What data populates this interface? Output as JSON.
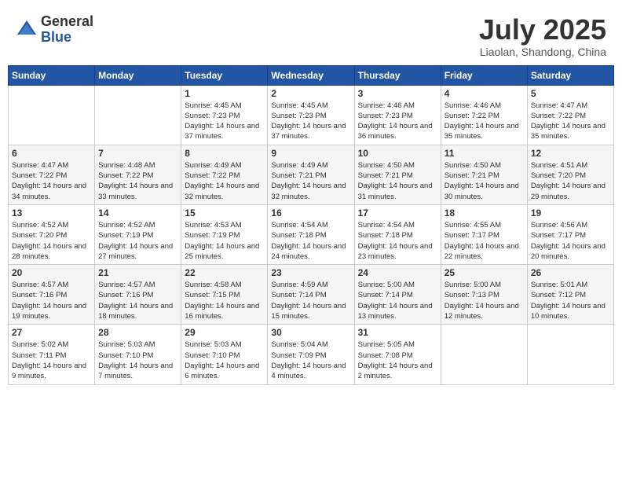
{
  "header": {
    "logo_general": "General",
    "logo_blue": "Blue",
    "month_title": "July 2025",
    "location": "Liaolan, Shandong, China"
  },
  "calendar": {
    "days_of_week": [
      "Sunday",
      "Monday",
      "Tuesday",
      "Wednesday",
      "Thursday",
      "Friday",
      "Saturday"
    ],
    "weeks": [
      [
        {
          "day": "",
          "info": ""
        },
        {
          "day": "",
          "info": ""
        },
        {
          "day": "1",
          "info": "Sunrise: 4:45 AM\nSunset: 7:23 PM\nDaylight: 14 hours and 37 minutes."
        },
        {
          "day": "2",
          "info": "Sunrise: 4:45 AM\nSunset: 7:23 PM\nDaylight: 14 hours and 37 minutes."
        },
        {
          "day": "3",
          "info": "Sunrise: 4:46 AM\nSunset: 7:23 PM\nDaylight: 14 hours and 36 minutes."
        },
        {
          "day": "4",
          "info": "Sunrise: 4:46 AM\nSunset: 7:22 PM\nDaylight: 14 hours and 35 minutes."
        },
        {
          "day": "5",
          "info": "Sunrise: 4:47 AM\nSunset: 7:22 PM\nDaylight: 14 hours and 35 minutes."
        }
      ],
      [
        {
          "day": "6",
          "info": "Sunrise: 4:47 AM\nSunset: 7:22 PM\nDaylight: 14 hours and 34 minutes."
        },
        {
          "day": "7",
          "info": "Sunrise: 4:48 AM\nSunset: 7:22 PM\nDaylight: 14 hours and 33 minutes."
        },
        {
          "day": "8",
          "info": "Sunrise: 4:49 AM\nSunset: 7:22 PM\nDaylight: 14 hours and 32 minutes."
        },
        {
          "day": "9",
          "info": "Sunrise: 4:49 AM\nSunset: 7:21 PM\nDaylight: 14 hours and 32 minutes."
        },
        {
          "day": "10",
          "info": "Sunrise: 4:50 AM\nSunset: 7:21 PM\nDaylight: 14 hours and 31 minutes."
        },
        {
          "day": "11",
          "info": "Sunrise: 4:50 AM\nSunset: 7:21 PM\nDaylight: 14 hours and 30 minutes."
        },
        {
          "day": "12",
          "info": "Sunrise: 4:51 AM\nSunset: 7:20 PM\nDaylight: 14 hours and 29 minutes."
        }
      ],
      [
        {
          "day": "13",
          "info": "Sunrise: 4:52 AM\nSunset: 7:20 PM\nDaylight: 14 hours and 28 minutes."
        },
        {
          "day": "14",
          "info": "Sunrise: 4:52 AM\nSunset: 7:19 PM\nDaylight: 14 hours and 27 minutes."
        },
        {
          "day": "15",
          "info": "Sunrise: 4:53 AM\nSunset: 7:19 PM\nDaylight: 14 hours and 25 minutes."
        },
        {
          "day": "16",
          "info": "Sunrise: 4:54 AM\nSunset: 7:18 PM\nDaylight: 14 hours and 24 minutes."
        },
        {
          "day": "17",
          "info": "Sunrise: 4:54 AM\nSunset: 7:18 PM\nDaylight: 14 hours and 23 minutes."
        },
        {
          "day": "18",
          "info": "Sunrise: 4:55 AM\nSunset: 7:17 PM\nDaylight: 14 hours and 22 minutes."
        },
        {
          "day": "19",
          "info": "Sunrise: 4:56 AM\nSunset: 7:17 PM\nDaylight: 14 hours and 20 minutes."
        }
      ],
      [
        {
          "day": "20",
          "info": "Sunrise: 4:57 AM\nSunset: 7:16 PM\nDaylight: 14 hours and 19 minutes."
        },
        {
          "day": "21",
          "info": "Sunrise: 4:57 AM\nSunset: 7:16 PM\nDaylight: 14 hours and 18 minutes."
        },
        {
          "day": "22",
          "info": "Sunrise: 4:58 AM\nSunset: 7:15 PM\nDaylight: 14 hours and 16 minutes."
        },
        {
          "day": "23",
          "info": "Sunrise: 4:59 AM\nSunset: 7:14 PM\nDaylight: 14 hours and 15 minutes."
        },
        {
          "day": "24",
          "info": "Sunrise: 5:00 AM\nSunset: 7:14 PM\nDaylight: 14 hours and 13 minutes."
        },
        {
          "day": "25",
          "info": "Sunrise: 5:00 AM\nSunset: 7:13 PM\nDaylight: 14 hours and 12 minutes."
        },
        {
          "day": "26",
          "info": "Sunrise: 5:01 AM\nSunset: 7:12 PM\nDaylight: 14 hours and 10 minutes."
        }
      ],
      [
        {
          "day": "27",
          "info": "Sunrise: 5:02 AM\nSunset: 7:11 PM\nDaylight: 14 hours and 9 minutes."
        },
        {
          "day": "28",
          "info": "Sunrise: 5:03 AM\nSunset: 7:10 PM\nDaylight: 14 hours and 7 minutes."
        },
        {
          "day": "29",
          "info": "Sunrise: 5:03 AM\nSunset: 7:10 PM\nDaylight: 14 hours and 6 minutes."
        },
        {
          "day": "30",
          "info": "Sunrise: 5:04 AM\nSunset: 7:09 PM\nDaylight: 14 hours and 4 minutes."
        },
        {
          "day": "31",
          "info": "Sunrise: 5:05 AM\nSunset: 7:08 PM\nDaylight: 14 hours and 2 minutes."
        },
        {
          "day": "",
          "info": ""
        },
        {
          "day": "",
          "info": ""
        }
      ]
    ]
  }
}
